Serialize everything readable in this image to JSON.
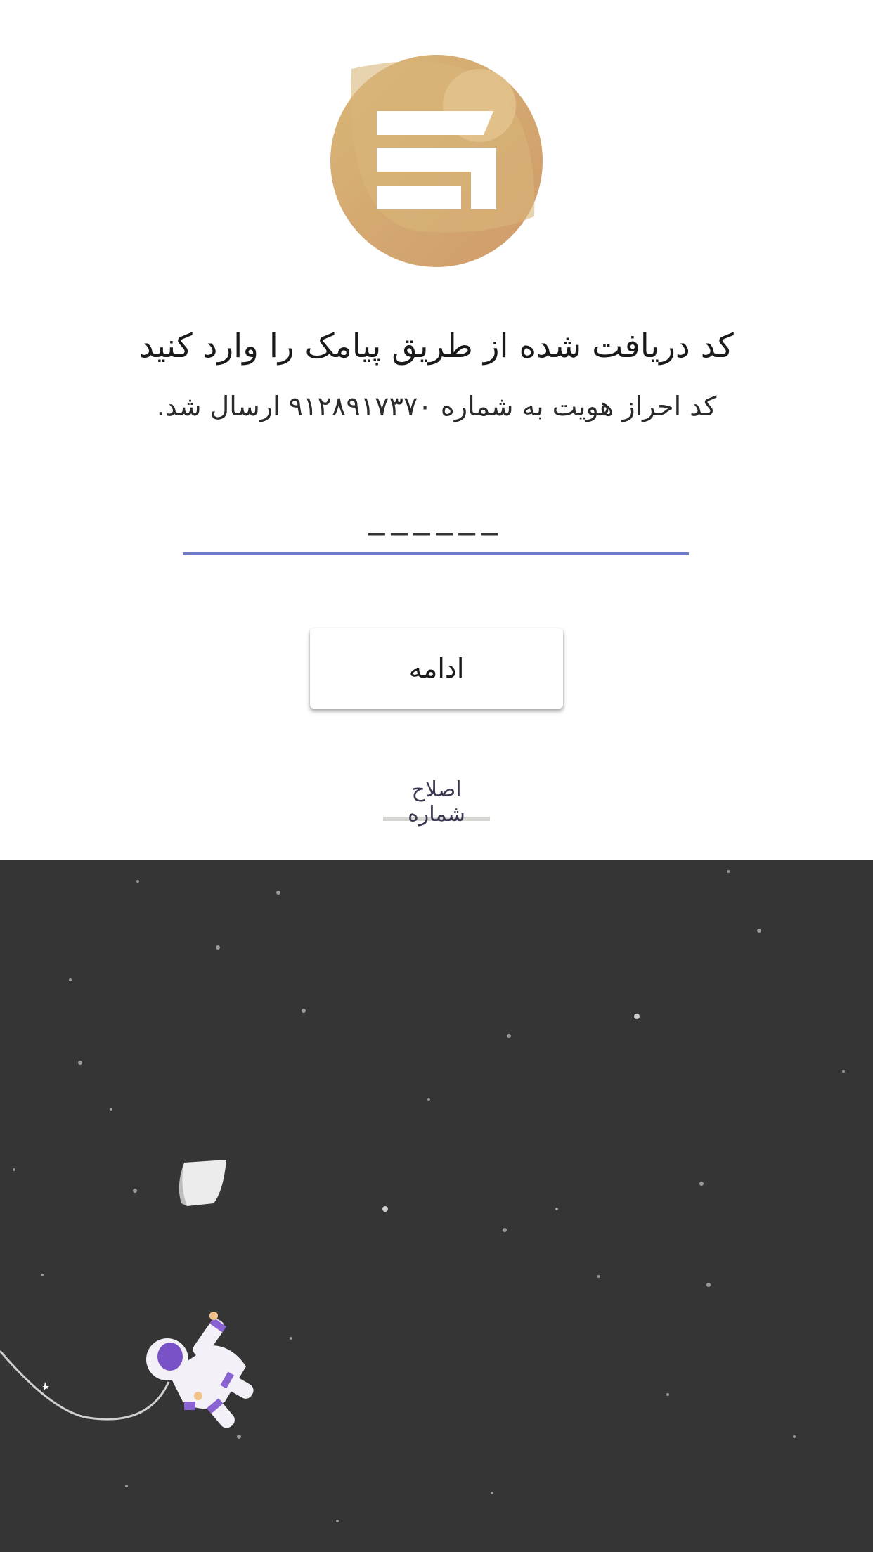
{
  "header": {
    "title": "کد دریافت شده از طریق پیامک را وارد کنید",
    "subtitle": "کد احراز هویت به شماره ۹۱۲۸۹۱۷۳۷۰ ارسال شد."
  },
  "form": {
    "code_value": "",
    "code_placeholder": "––––––",
    "continue_label": "ادامه",
    "edit_number_label": "اصلاح شماره"
  },
  "colors": {
    "logo_gold": "#d4ae72",
    "input_underline": "#6f7ac9",
    "space_background": "#353535",
    "astronaut_accent": "#8a63d2"
  },
  "icons": {
    "logo": "brand-logo-icon",
    "illustration": "astronaut-illustration"
  }
}
